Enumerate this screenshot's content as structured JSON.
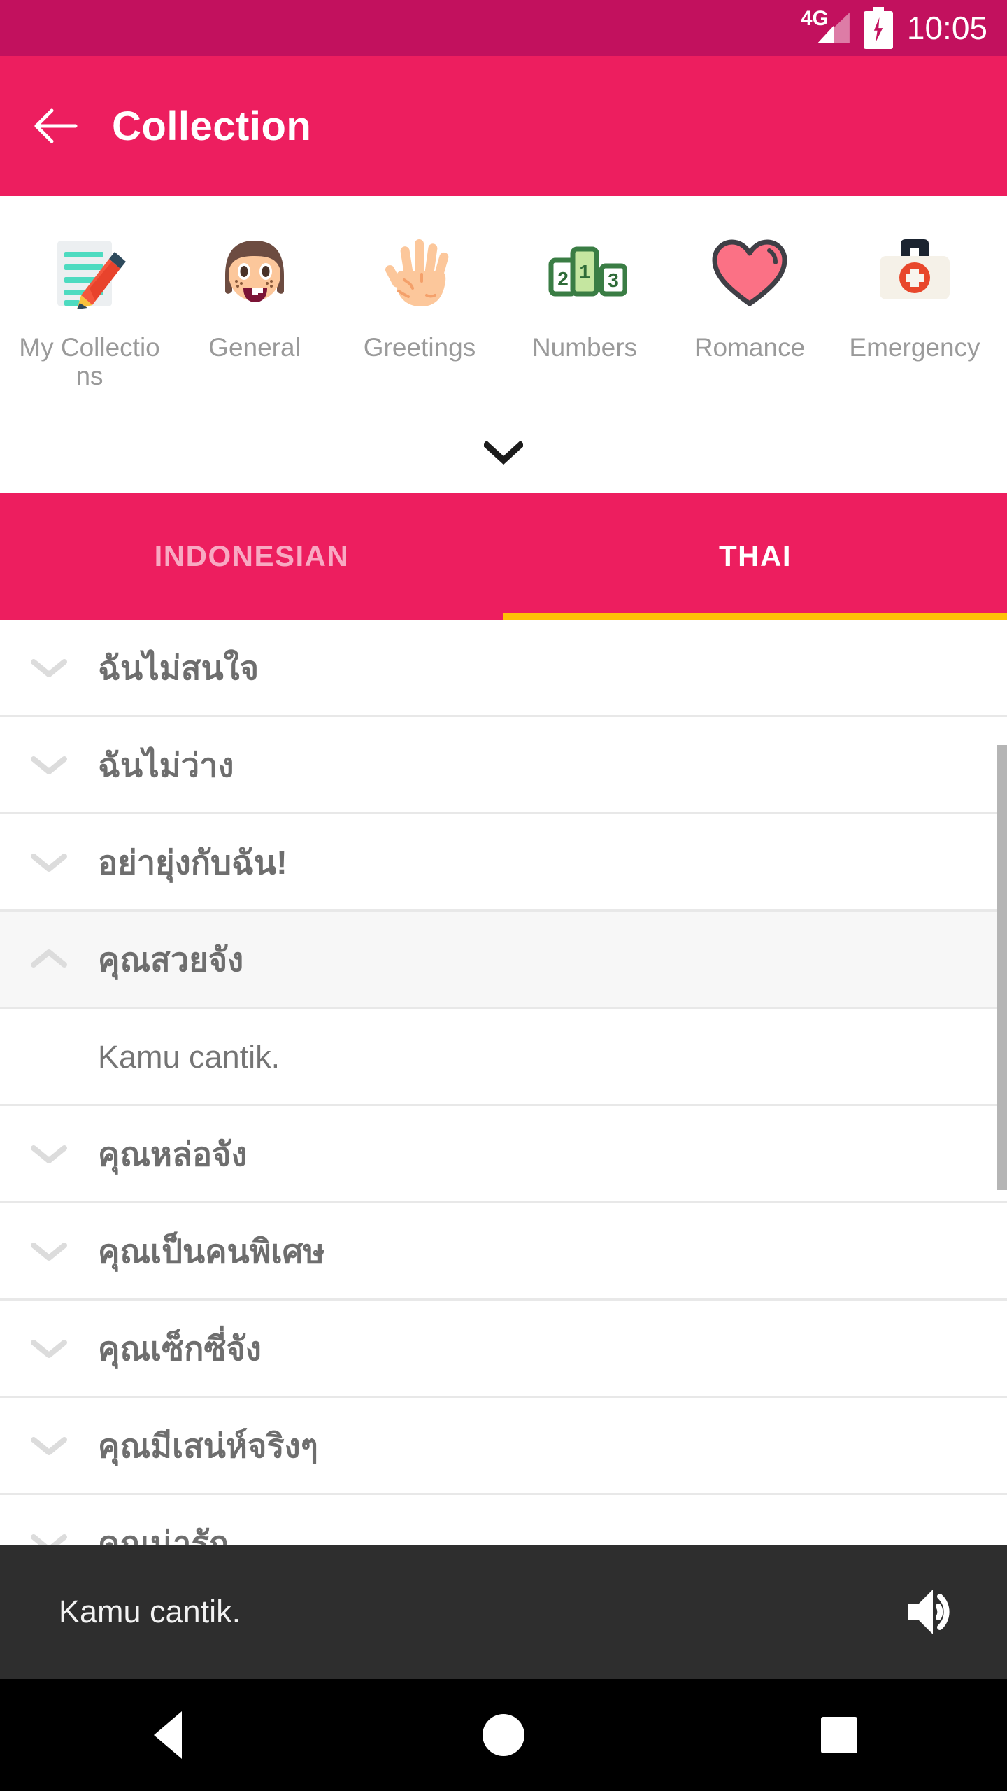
{
  "status_bar": {
    "network": "4G",
    "battery_icon": "battery-charging-icon",
    "time": "10:05"
  },
  "app_bar": {
    "back_icon": "back-arrow-icon",
    "title": "Collection"
  },
  "categories": {
    "expand_icon": "chevron-down-icon",
    "items": [
      {
        "label": "My Collections",
        "icon": "memo-pencil-icon"
      },
      {
        "label": "General",
        "icon": "girl-face-icon"
      },
      {
        "label": "Greetings",
        "icon": "open-hand-icon"
      },
      {
        "label": "Numbers",
        "icon": "podium-icon"
      },
      {
        "label": "Romance",
        "icon": "heart-icon"
      },
      {
        "label": "Emergency",
        "icon": "first-aid-kit-icon"
      }
    ]
  },
  "language_tabs": {
    "tabs": [
      {
        "label": "INDONESIAN",
        "active": false
      },
      {
        "label": "THAI",
        "active": true
      }
    ],
    "indicator_color": "#ffc107"
  },
  "phrase_list": {
    "rows": [
      {
        "text": "ฉันไม่สนใจ",
        "type": "phrase",
        "expanded": false,
        "chevron": "chevron-down-icon"
      },
      {
        "text": "ฉันไม่ว่าง",
        "type": "phrase",
        "expanded": false,
        "chevron": "chevron-down-icon"
      },
      {
        "text": "อย่ายุ่งกับฉัน!",
        "type": "phrase",
        "expanded": false,
        "chevron": "chevron-down-icon"
      },
      {
        "text": "คุณสวยจัง",
        "type": "phrase",
        "expanded": true,
        "chevron": "chevron-up-icon"
      },
      {
        "text": "Kamu cantik.",
        "type": "translation",
        "expanded": false,
        "chevron": ""
      },
      {
        "text": "คุณหล่อจัง",
        "type": "phrase",
        "expanded": false,
        "chevron": "chevron-down-icon"
      },
      {
        "text": "คุณเป็นคนพิเศษ",
        "type": "phrase",
        "expanded": false,
        "chevron": "chevron-down-icon"
      },
      {
        "text": "คุณเซ็กซี่จัง",
        "type": "phrase",
        "expanded": false,
        "chevron": "chevron-down-icon"
      },
      {
        "text": "คุณมีเสน่ห์จริงๆ",
        "type": "phrase",
        "expanded": false,
        "chevron": "chevron-down-icon"
      },
      {
        "text": "คุณน่ารัก",
        "type": "phrase",
        "expanded": false,
        "chevron": "chevron-down-icon"
      }
    ]
  },
  "playback_bar": {
    "text": "Kamu cantik.",
    "speaker_icon": "speaker-volume-icon"
  },
  "nav_bar": {
    "back": "android-back-icon",
    "home": "android-home-icon",
    "recents": "android-recents-icon"
  },
  "colors": {
    "status_bar": "#c2115e",
    "app_bar": "#ed1e5f",
    "tab_indicator": "#ffc107",
    "playback_bar": "#2e2e2e"
  }
}
